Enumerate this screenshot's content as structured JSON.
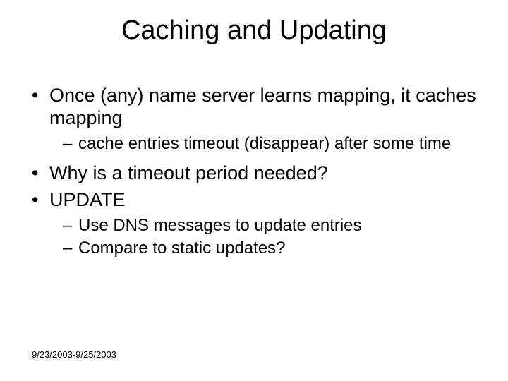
{
  "title": "Caching and Updating",
  "bullets": {
    "b1": "Once (any) name server learns mapping, it caches mapping",
    "b1_s1": "cache entries timeout (disappear) after some time",
    "b2": "Why is a timeout period needed?",
    "b3": "UPDATE",
    "b3_s1": "Use DNS messages to update entries",
    "b3_s2": "Compare to static updates?"
  },
  "footer": "9/23/2003-9/25/2003",
  "marks": {
    "dot": "•",
    "dash": "–"
  }
}
